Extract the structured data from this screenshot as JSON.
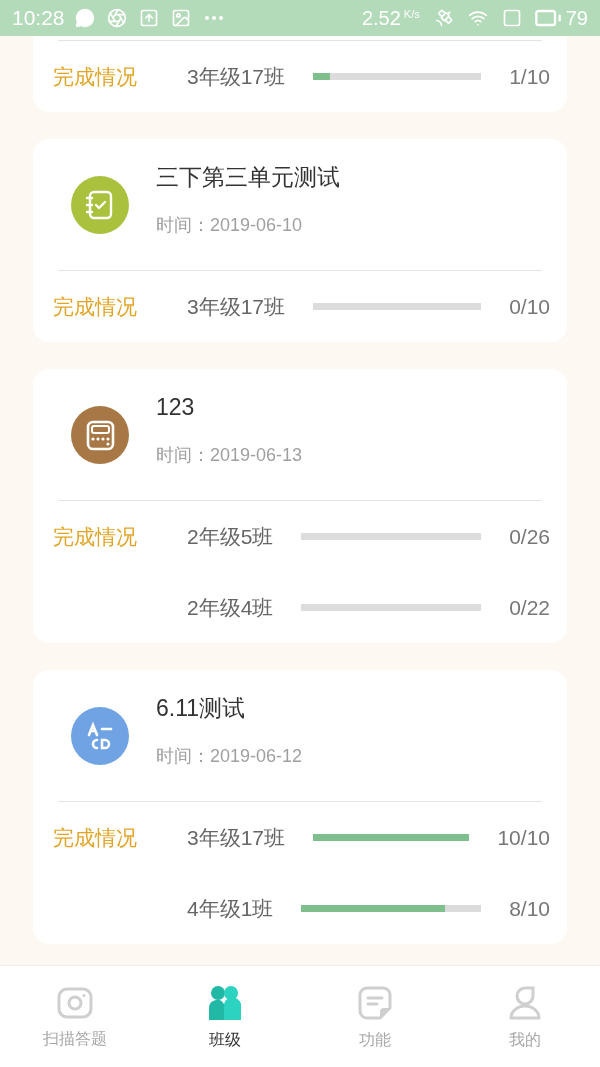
{
  "status_bar": {
    "time": "10:28",
    "speed": "2.52",
    "speed_unit": "K/s",
    "battery": "79"
  },
  "cards": [
    {
      "rows": [
        {
          "class": "3年级17班",
          "level": 0.1,
          "count": "1/10"
        }
      ],
      "status_label": "完成情况"
    },
    {
      "kind": "notebook",
      "color": "#a9c13c",
      "title": "三下第三单元测试",
      "time": "时间：2019-06-10",
      "status_label": "完成情况",
      "rows": [
        {
          "class": "3年级17班",
          "level": 0,
          "count": "0/10"
        }
      ]
    },
    {
      "kind": "calculator",
      "color": "#a87746",
      "title": "123",
      "time": "时间：2019-06-13",
      "status_label": "完成情况",
      "rows": [
        {
          "class": "2年级5班",
          "level": 0,
          "count": "0/26"
        },
        {
          "class": "2年级4班",
          "level": 0,
          "count": "0/22"
        }
      ]
    },
    {
      "kind": "fill-blank",
      "color": "#6fa3e3",
      "title": "6.11测试",
      "time": "时间：2019-06-12",
      "status_label": "完成情况",
      "rows": [
        {
          "class": "3年级17班",
          "level": 1,
          "count": "10/10"
        },
        {
          "class": "4年级1班",
          "level": 0.8,
          "count": "8/10"
        }
      ]
    }
  ],
  "nav": [
    {
      "kind": "camera",
      "label": "扫描答题",
      "selected": false
    },
    {
      "kind": "people",
      "label": "班级",
      "selected": true
    },
    {
      "kind": "note",
      "label": "功能",
      "selected": false
    },
    {
      "kind": "person",
      "label": "我的",
      "selected": false
    }
  ]
}
